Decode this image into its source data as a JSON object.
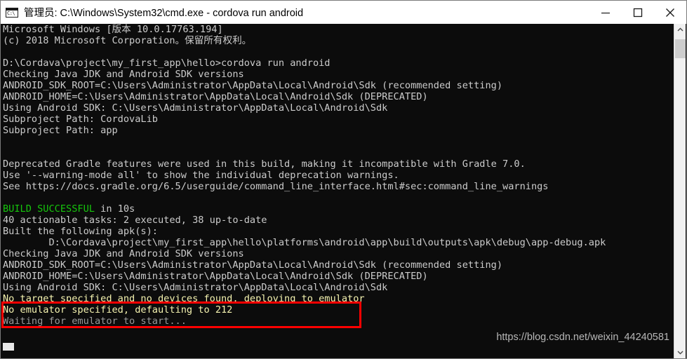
{
  "window": {
    "title": "管理员: C:\\Windows\\System32\\cmd.exe - cordova  run android",
    "icon_name": "cmd-console-icon",
    "icon_glyph": "C:\\",
    "controls": {
      "minimize_label": "Minimize",
      "maximize_label": "Maximize",
      "close_label": "Close"
    },
    "colors": {
      "titlebar_bg": "#ffffff",
      "console_bg": "#0c0c0c",
      "default_text": "#cccccc",
      "success_text": "#16c60c",
      "highlight_text": "#f5f3b0",
      "dim_text": "#9a9a9a",
      "annotation": "#ff0000"
    }
  },
  "console": {
    "lines": [
      {
        "text": "Microsoft Windows [版本 10.0.17763.194]",
        "color": "white"
      },
      {
        "text": "(c) 2018 Microsoft Corporation。保留所有权利。",
        "color": "white"
      },
      {
        "text": "",
        "color": "white"
      },
      {
        "text": "D:\\Cordava\\project\\my_first_app\\hello>cordova run android",
        "color": "white"
      },
      {
        "text": "Checking Java JDK and Android SDK versions",
        "color": "white"
      },
      {
        "text": "ANDROID_SDK_ROOT=C:\\Users\\Administrator\\AppData\\Local\\Android\\Sdk (recommended setting)",
        "color": "white"
      },
      {
        "text": "ANDROID_HOME=C:\\Users\\Administrator\\AppData\\Local\\Android\\Sdk (DEPRECATED)",
        "color": "white"
      },
      {
        "text": "Using Android SDK: C:\\Users\\Administrator\\AppData\\Local\\Android\\Sdk",
        "color": "white"
      },
      {
        "text": "Subproject Path: CordovaLib",
        "color": "white"
      },
      {
        "text": "Subproject Path: app",
        "color": "white"
      },
      {
        "text": "",
        "color": "white"
      },
      {
        "text": "",
        "color": "white"
      },
      {
        "text": "Deprecated Gradle features were used in this build, making it incompatible with Gradle 7.0.",
        "color": "white"
      },
      {
        "text": "Use '--warning-mode all' to show the individual deprecation warnings.",
        "color": "white"
      },
      {
        "text": "See https://docs.gradle.org/6.5/userguide/command_line_interface.html#sec:command_line_warnings",
        "color": "white"
      },
      {
        "text": "",
        "color": "white"
      },
      {
        "text": "BUILD SUCCESSFUL in 10s",
        "color": "green",
        "green_prefix": "BUILD SUCCESSFUL",
        "white_suffix": " in 10s"
      },
      {
        "text": "40 actionable tasks: 2 executed, 38 up-to-date",
        "color": "white"
      },
      {
        "text": "Built the following apk(s):",
        "color": "white"
      },
      {
        "text": "        D:\\Cordava\\project\\my_first_app\\hello\\platforms\\android\\app\\build\\outputs\\apk\\debug\\app-debug.apk",
        "color": "white"
      },
      {
        "text": "Checking Java JDK and Android SDK versions",
        "color": "white"
      },
      {
        "text": "ANDROID_SDK_ROOT=C:\\Users\\Administrator\\AppData\\Local\\Android\\Sdk (recommended setting)",
        "color": "white"
      },
      {
        "text": "ANDROID_HOME=C:\\Users\\Administrator\\AppData\\Local\\Android\\Sdk (DEPRECATED)",
        "color": "white"
      },
      {
        "text": "Using Android SDK: C:\\Users\\Administrator\\AppData\\Local\\Android\\Sdk",
        "color": "white"
      },
      {
        "text": "No target specified and no devices found, deploying to emulator",
        "color": "yellow"
      },
      {
        "text": "No emulator specified, defaulting to 212",
        "color": "yellow"
      },
      {
        "text": "Waiting for emulator to start...",
        "color": "dim"
      }
    ]
  },
  "annotation": {
    "name": "red-highlight-box",
    "covers_lines": [
      "No target specified and no devices found, deploying to emulator",
      "No emulator specified, defaulting to 212"
    ]
  },
  "watermark": {
    "text": "https://blog.csdn.net/weixin_44240581"
  },
  "scrollbar": {
    "up_arrow": "▲",
    "down_arrow": "▼"
  }
}
